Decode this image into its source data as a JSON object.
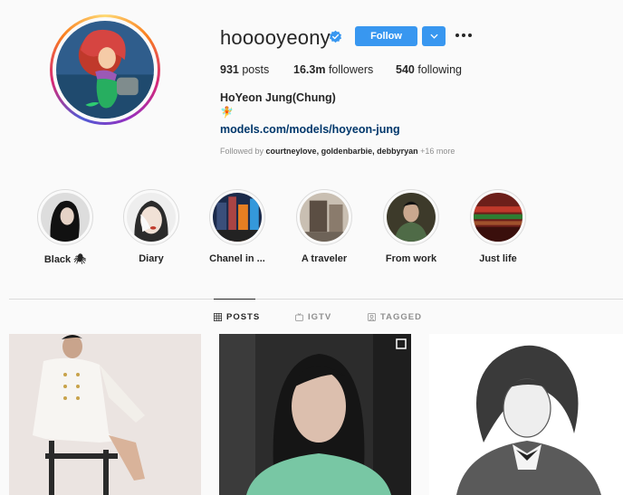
{
  "profile": {
    "username": "hooooyeony",
    "follow_label": "Follow",
    "full_name": "HoYeon Jung(Chung)",
    "bio_emoji": "🧚",
    "link": "models.com/models/hoyeon-jung",
    "followed_by_prefix": "Followed by",
    "followed_by_names": "courtneylove, goldenbarbie, debbyryan",
    "followed_by_more": "+16 more"
  },
  "stats": {
    "posts_count": "931",
    "posts_label": "posts",
    "followers_count": "16.3m",
    "followers_label": "followers",
    "following_count": "540",
    "following_label": "following"
  },
  "highlights": [
    {
      "label": "Black 🕷"
    },
    {
      "label": "Diary"
    },
    {
      "label": "Chanel in ..."
    },
    {
      "label": "A traveler"
    },
    {
      "label": "From work"
    },
    {
      "label": "Just life"
    }
  ],
  "tabs": {
    "posts": "POSTS",
    "igtv": "IGTV",
    "tagged": "TAGGED"
  },
  "colors": {
    "follow_blue": "#3897f0",
    "link_blue": "#00376b",
    "verified_blue": "#3897f0"
  }
}
